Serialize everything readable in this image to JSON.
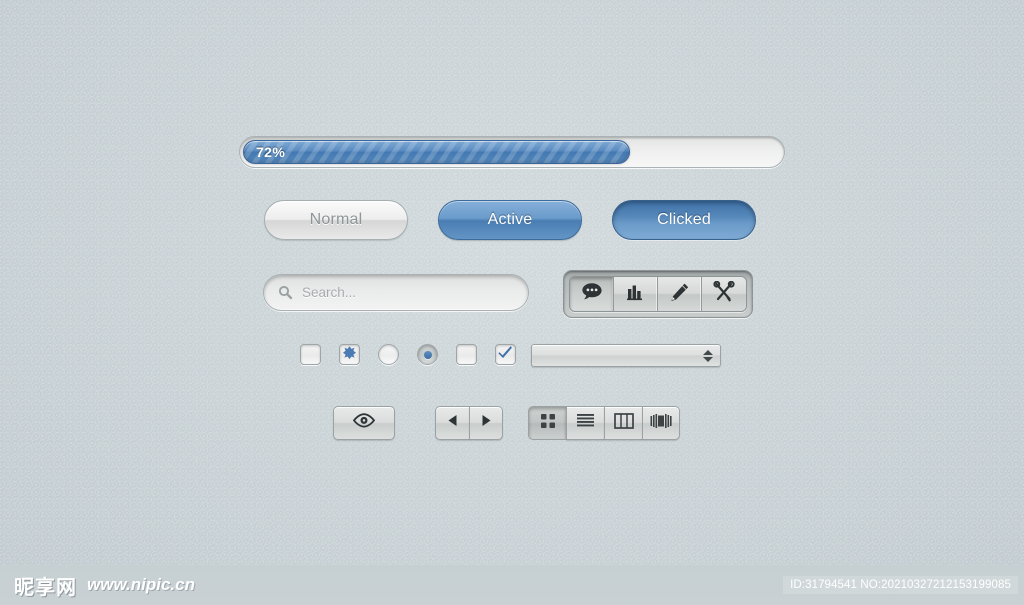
{
  "progress": {
    "label": "72%",
    "percent": 72,
    "fill_color": "#4379b2",
    "track_color": "#eeefee"
  },
  "buttons": [
    {
      "label": "Normal",
      "state": "normal",
      "name": "normal-button"
    },
    {
      "label": "Active",
      "state": "active",
      "name": "active-button"
    },
    {
      "label": "Clicked",
      "state": "clicked",
      "name": "clicked-button"
    }
  ],
  "search": {
    "placeholder": "Search...",
    "value": "",
    "icon": "search-icon"
  },
  "icon_toolbar": {
    "items": [
      {
        "icon": "chat-bubble-icon",
        "selected": true
      },
      {
        "icon": "bar-chart-icon",
        "selected": false
      },
      {
        "icon": "pencil-icon",
        "selected": false
      },
      {
        "icon": "tools-icon",
        "selected": false
      }
    ]
  },
  "toggles": [
    {
      "type": "checkbox",
      "name": "checkbox-empty-1",
      "checked": false,
      "mark": "none"
    },
    {
      "type": "checkbox",
      "name": "checkbox-cross",
      "checked": true,
      "mark": "cross"
    },
    {
      "type": "radio",
      "name": "radio-empty",
      "checked": false
    },
    {
      "type": "radio",
      "name": "radio-selected",
      "checked": true
    },
    {
      "type": "checkbox",
      "name": "checkbox-empty-2",
      "checked": false,
      "mark": "none"
    },
    {
      "type": "checkbox",
      "name": "checkbox-tick",
      "checked": true,
      "mark": "tick"
    }
  ],
  "stepper": {
    "value": "",
    "up_icon": "arrow-up-icon",
    "down_icon": "arrow-down-icon"
  },
  "bottom_controls": {
    "eye": {
      "icon": "eye-icon"
    },
    "nav": [
      {
        "icon": "arrow-left-icon",
        "name": "back-button"
      },
      {
        "icon": "arrow-right-icon",
        "name": "forward-button"
      }
    ],
    "views": [
      {
        "icon": "grid-view-icon",
        "name": "view-icon-grid",
        "selected": true
      },
      {
        "icon": "list-view-icon",
        "name": "view-list",
        "selected": false
      },
      {
        "icon": "column-view-icon",
        "name": "view-columns",
        "selected": false
      },
      {
        "icon": "coverflow-icon",
        "name": "view-coverflow",
        "selected": false
      }
    ]
  },
  "watermark": {
    "logo": "昵享网",
    "url": "www.nipic.cn",
    "id_text": "ID:31794541 NO:20210327212153199085"
  },
  "theme": {
    "background": "#ccd5d8",
    "accent_blue": "#4379b2",
    "chrome_gray": "#d7dad9"
  }
}
